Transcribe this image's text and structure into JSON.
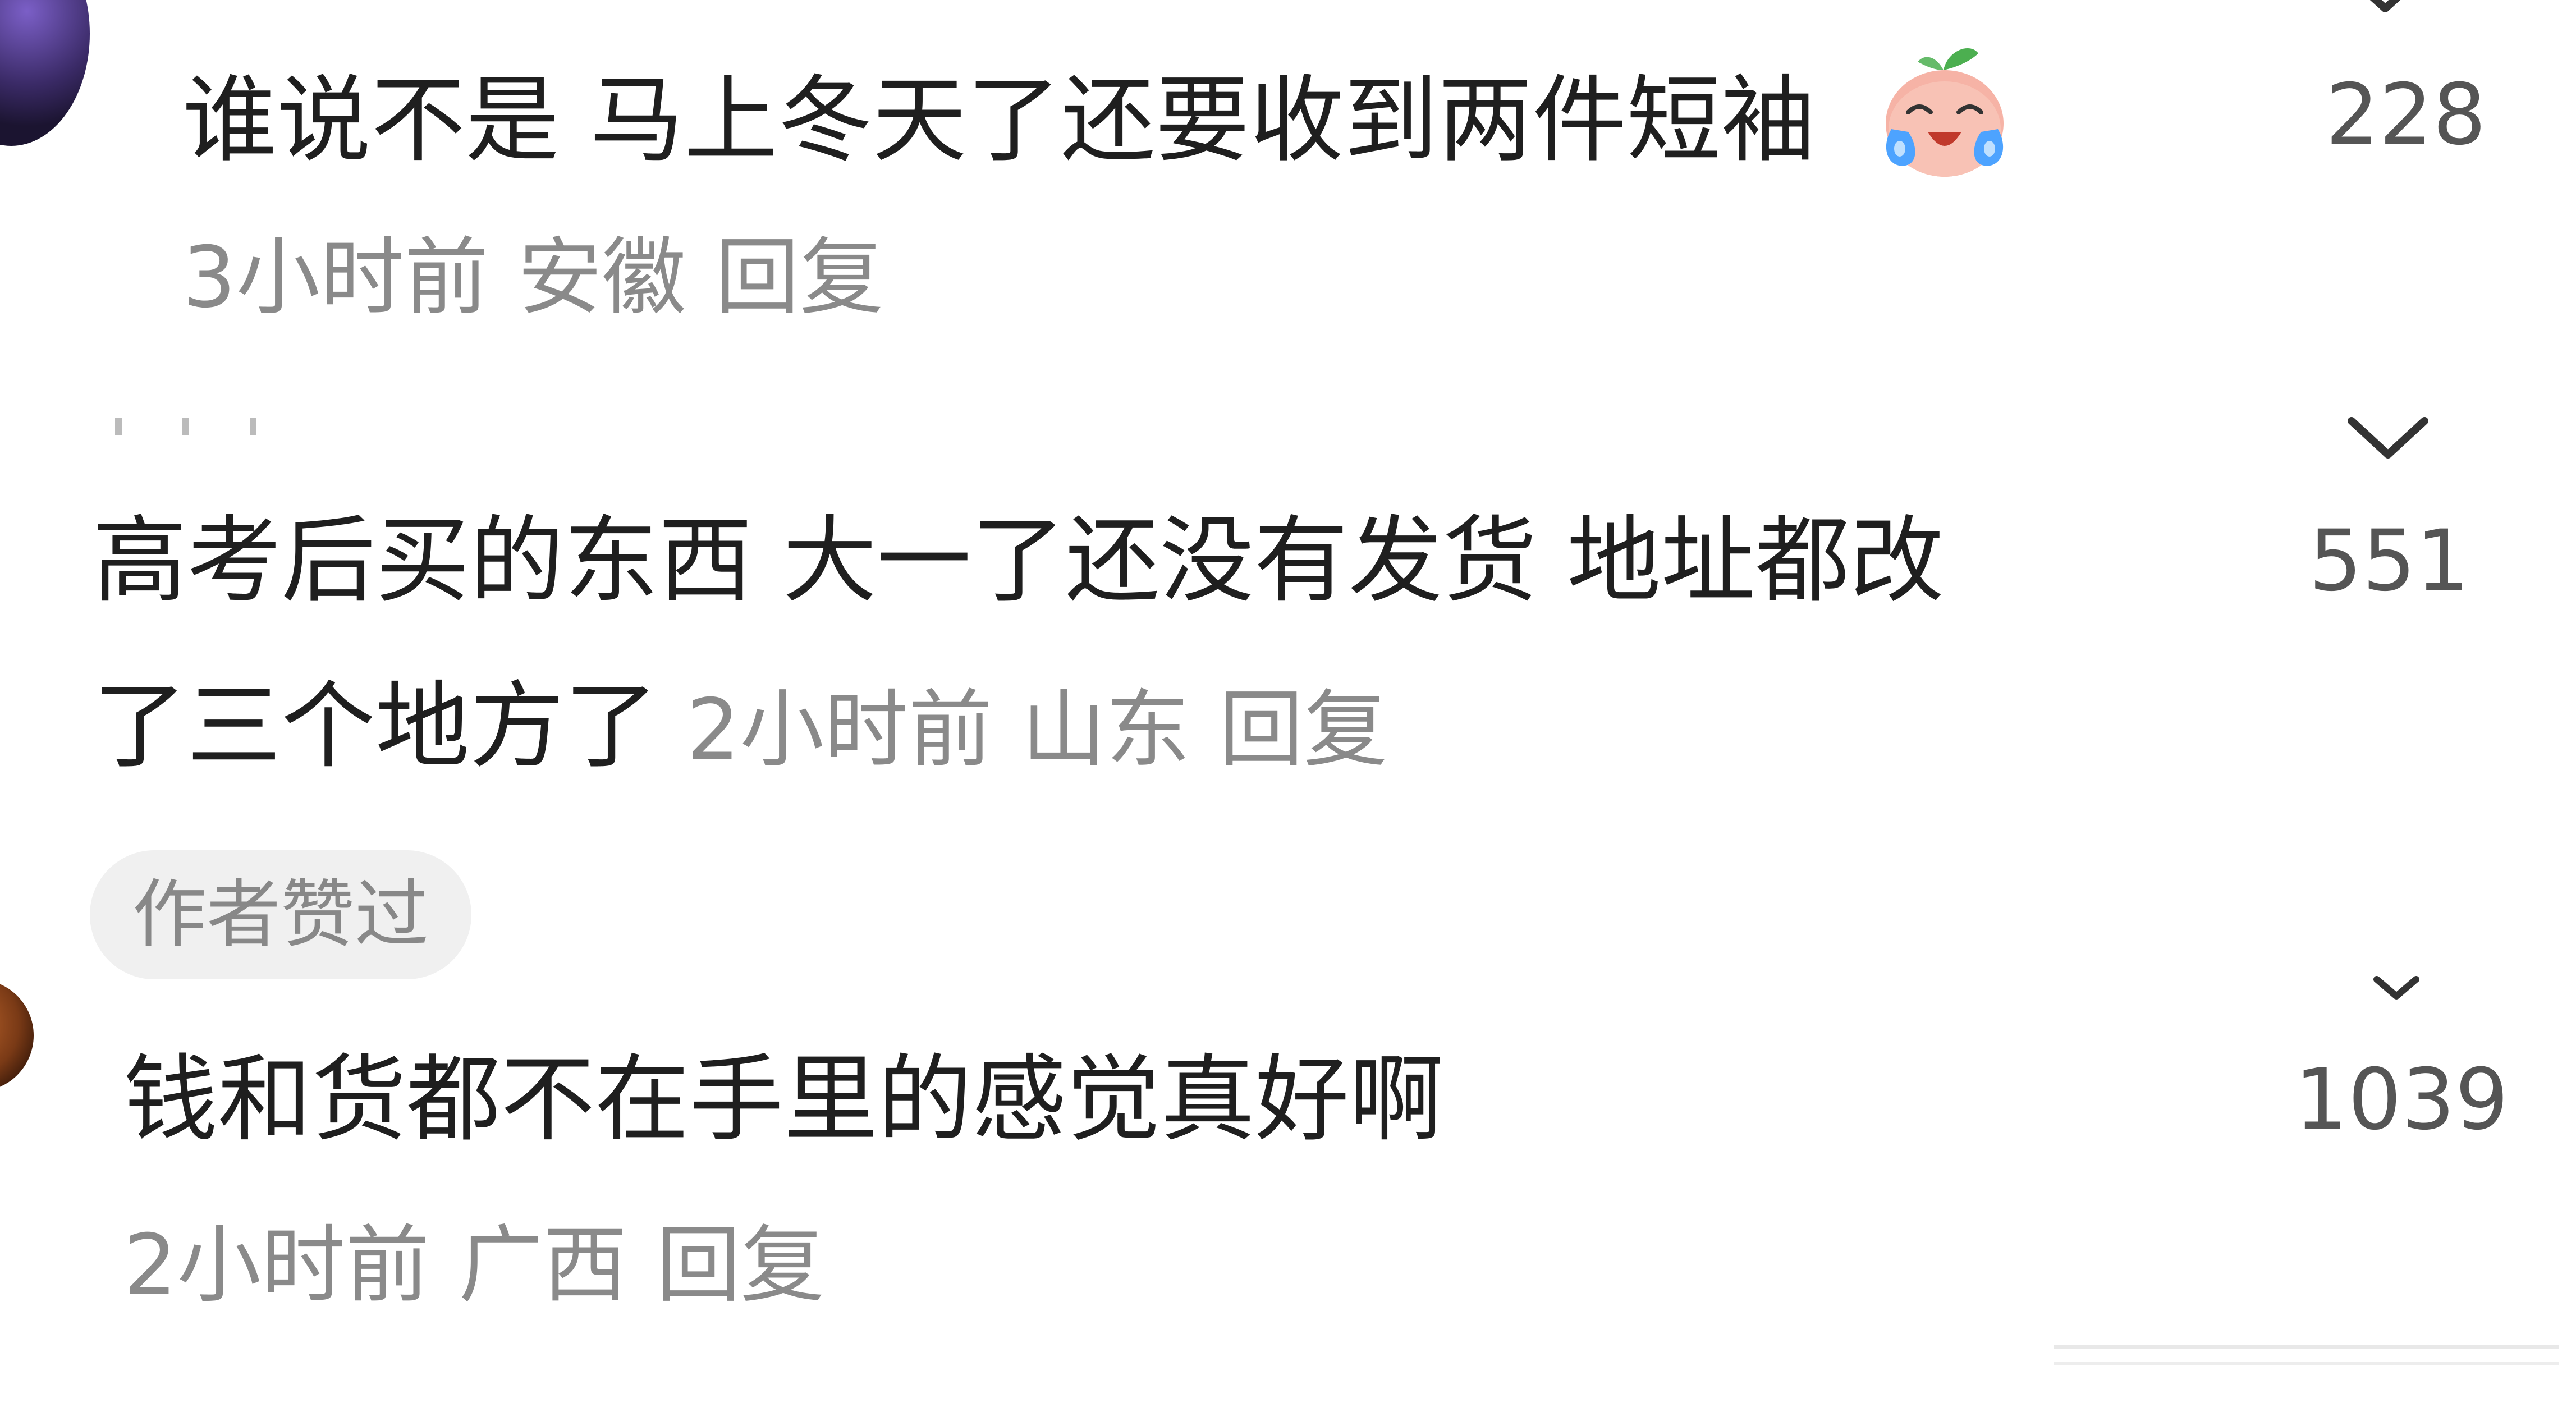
{
  "comments": [
    {
      "text": "谁说不是 马上冬天了还要收到两件短袖",
      "emoji": "crying-laughing-emoji",
      "time": "3小时前",
      "location": "安徽",
      "reply": "回复",
      "likes": "228"
    },
    {
      "text_line1": "高考后买的东西 大一了还没有发货 地址都改",
      "text_line2": "了三个地方了",
      "time": "2小时前",
      "location": "山东",
      "reply": "回复",
      "likes": "551"
    },
    {
      "badge": "作者赞过",
      "text": "钱和货都不在手里的感觉真好啊",
      "time": "2小时前",
      "location": "广西",
      "reply": "回复",
      "likes": "1039"
    }
  ],
  "icons": {
    "like": "chevron-down-icon"
  },
  "colors": {
    "text": "#1f1f1f",
    "meta": "#8a8a8a",
    "count": "#555555",
    "badge_bg": "#f0f0f0"
  }
}
